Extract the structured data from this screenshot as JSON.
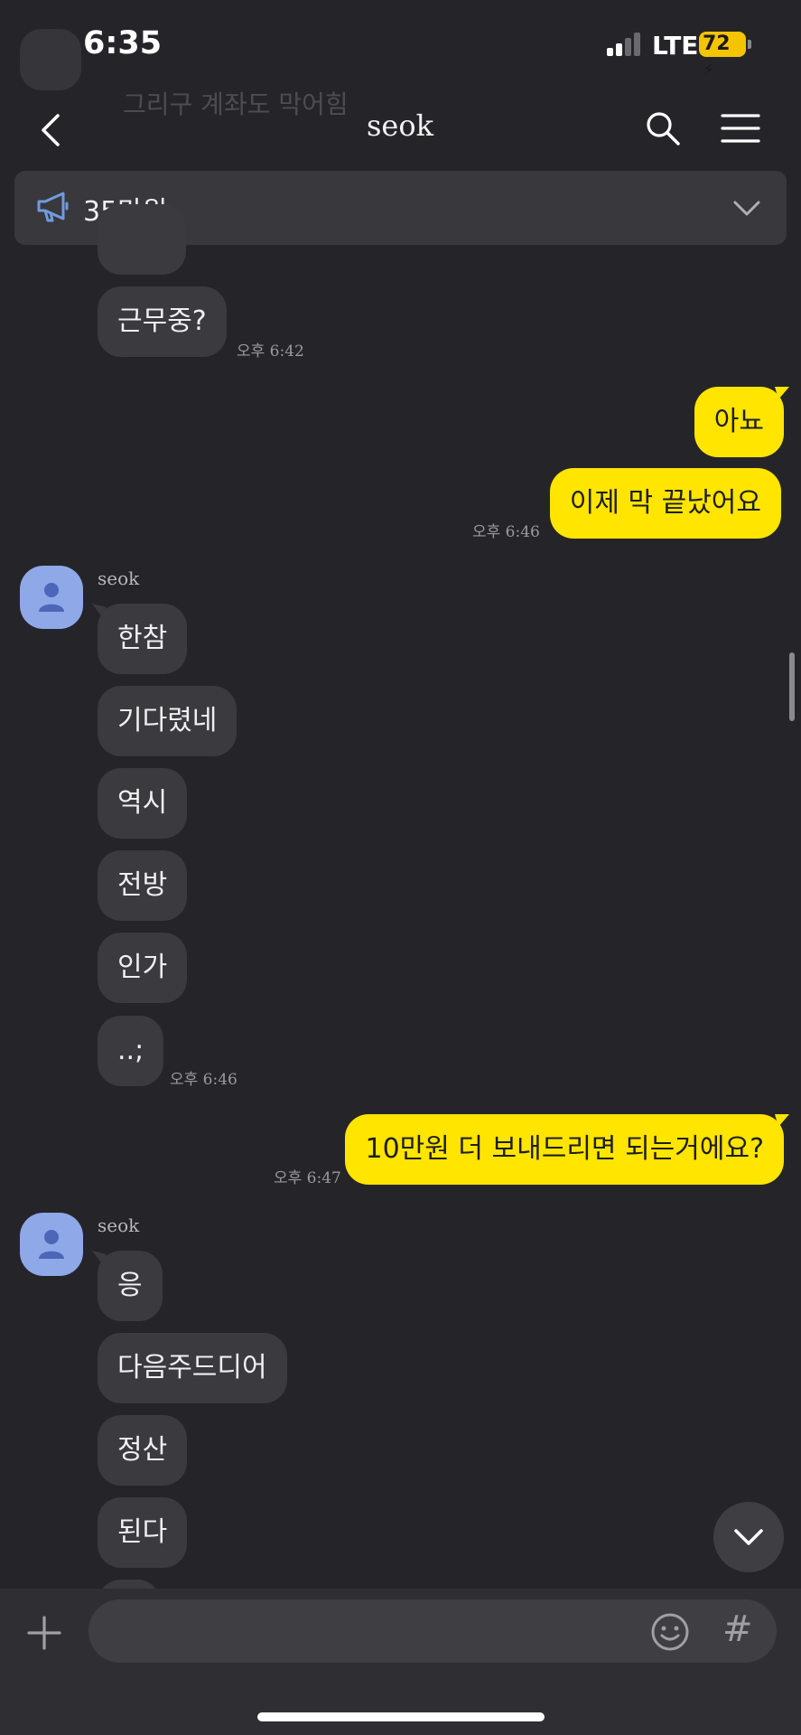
{
  "status_bar": {
    "time": "6:35",
    "network": "LTE",
    "battery": "72"
  },
  "background_preview": {
    "text": "그리구 계좌도 막어힘"
  },
  "header": {
    "title": "seok"
  },
  "notice": {
    "text": "35만원"
  },
  "messages": {
    "m0": {
      "text": "",
      "side": "in"
    },
    "m1": {
      "text": "근무중?",
      "side": "in",
      "time": "오후 6:42"
    },
    "m2": {
      "text": "아뇨",
      "side": "out"
    },
    "m3": {
      "text": "이제 막 끝났어요",
      "side": "out",
      "time": "오후 6:46"
    },
    "g1_sender": "seok",
    "m4": {
      "text": "한참",
      "side": "in"
    },
    "m5": {
      "text": "기다렸네",
      "side": "in"
    },
    "m6": {
      "text": "역시",
      "side": "in"
    },
    "m7": {
      "text": "전방",
      "side": "in"
    },
    "m8": {
      "text": "인가",
      "side": "in"
    },
    "m9": {
      "text": "..;",
      "side": "in",
      "time": "오후 6:46"
    },
    "m10": {
      "text": "10만원 더 보내드리면 되는거에요?",
      "side": "out",
      "time": "오후 6:47"
    },
    "g2_sender": "seok",
    "m11": {
      "text": "응",
      "side": "in"
    },
    "m12": {
      "text": "다음주드디어",
      "side": "in"
    },
    "m13": {
      "text": "정산",
      "side": "in"
    },
    "m14": {
      "text": "된다",
      "side": "in"
    }
  },
  "input": {
    "value": "",
    "placeholder": ""
  },
  "icons": {
    "back": "back-chevron-icon",
    "search": "search-icon",
    "menu": "hamburger-menu-icon",
    "notice": "megaphone-icon",
    "expand": "chevron-down-icon",
    "avatar": "person-icon",
    "scroll_down": "chevron-down-icon",
    "attach": "plus-icon",
    "emoji": "emoji-icon",
    "hash": "#"
  },
  "colors": {
    "background": "#252529",
    "incoming_bubble": "#3a3a3f",
    "outgoing_bubble": "#ffe500",
    "avatar": "#8fa8e8",
    "battery": "#f5c400",
    "notice_icon": "#6f9be0"
  }
}
